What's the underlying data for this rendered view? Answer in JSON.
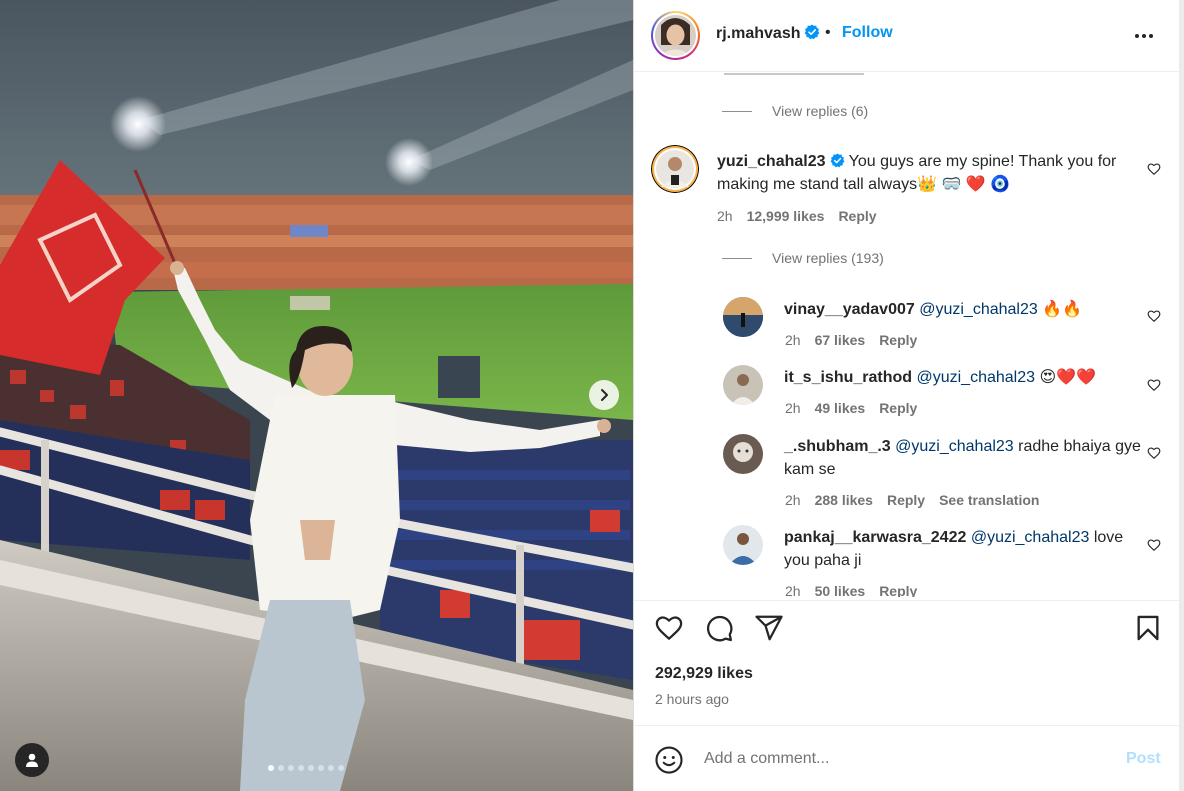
{
  "post": {
    "author": "rj.mahvash",
    "follow_label": "Follow",
    "separator": "•",
    "likes": "292,929 likes",
    "time_ago": "2 hours ago",
    "slide_count": 8,
    "active_slide": 0
  },
  "comments": {
    "first_view_replies": "View replies (6)",
    "main": {
      "username": "yuzi_chahal23",
      "text": "You guys are my spine! Thank you for making me stand tall always",
      "emojis": "👑 🥽 ❤️ 🧿",
      "time": "2h",
      "likes": "12,999 likes",
      "reply_label": "Reply",
      "view_replies": "View replies (193)"
    },
    "replies": [
      {
        "username": "vinay__yadav007",
        "mention": "@yuzi_chahal23",
        "text": "🔥🔥",
        "time": "2h",
        "likes": "67 likes",
        "reply_label": "Reply"
      },
      {
        "username": "it_s_ishu_rathod",
        "mention": "@yuzi_chahal23",
        "text": "😍❤️❤️",
        "time": "2h",
        "likes": "49 likes",
        "reply_label": "Reply"
      },
      {
        "username": "_.shubham_.3",
        "mention": "@yuzi_chahal23",
        "text": "radhe bhaiya gye kam se",
        "time": "2h",
        "likes": "288 likes",
        "reply_label": "Reply",
        "see_translation": "See translation"
      },
      {
        "username": "pankaj__karwasra_2422",
        "mention": "@yuzi_chahal23",
        "text": "love you paha ji",
        "time": "2h",
        "likes": "50 likes",
        "reply_label": "Reply"
      }
    ]
  },
  "composer": {
    "placeholder": "Add a comment...",
    "post_label": "Post"
  },
  "colors": {
    "link_blue": "#0095f6",
    "mention_blue": "#00376b",
    "muted": "#737373",
    "like_red": "#ed4956"
  },
  "icons": [
    "verified-badge-icon",
    "more-options-icon",
    "heart-icon",
    "comment-icon",
    "share-icon",
    "bookmark-icon",
    "emoji-icon",
    "tag-user-icon",
    "next-slide-icon"
  ]
}
